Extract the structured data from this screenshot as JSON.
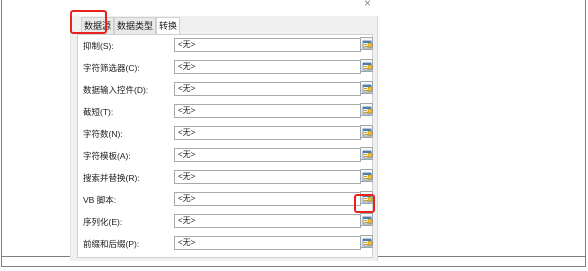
{
  "tabs": [
    {
      "label": "数据源"
    },
    {
      "label": "数据类型"
    },
    {
      "label": "转换"
    }
  ],
  "rows": [
    {
      "label": "抑制(S):",
      "value": "<无>"
    },
    {
      "label": "字符筛选器(C):",
      "value": "<无>"
    },
    {
      "label": "数据输入控件(D):",
      "value": "<无>"
    },
    {
      "label": "截短(T):",
      "value": "<无>"
    },
    {
      "label": "字符数(N):",
      "value": "<无>"
    },
    {
      "label": "字符模板(A):",
      "value": "<无>"
    },
    {
      "label": "搜索并替换(R):",
      "value": "<无>"
    },
    {
      "label": "VB 脚本:",
      "value": "<无>"
    },
    {
      "label": "序列化(E):",
      "value": "<无>"
    },
    {
      "label": "前缀和后缀(P):",
      "value": "<无>"
    }
  ],
  "close_glyph": "×",
  "icons": {
    "row_button": "edit-properties-icon"
  },
  "colors": {
    "highlight": "#e8231b"
  }
}
